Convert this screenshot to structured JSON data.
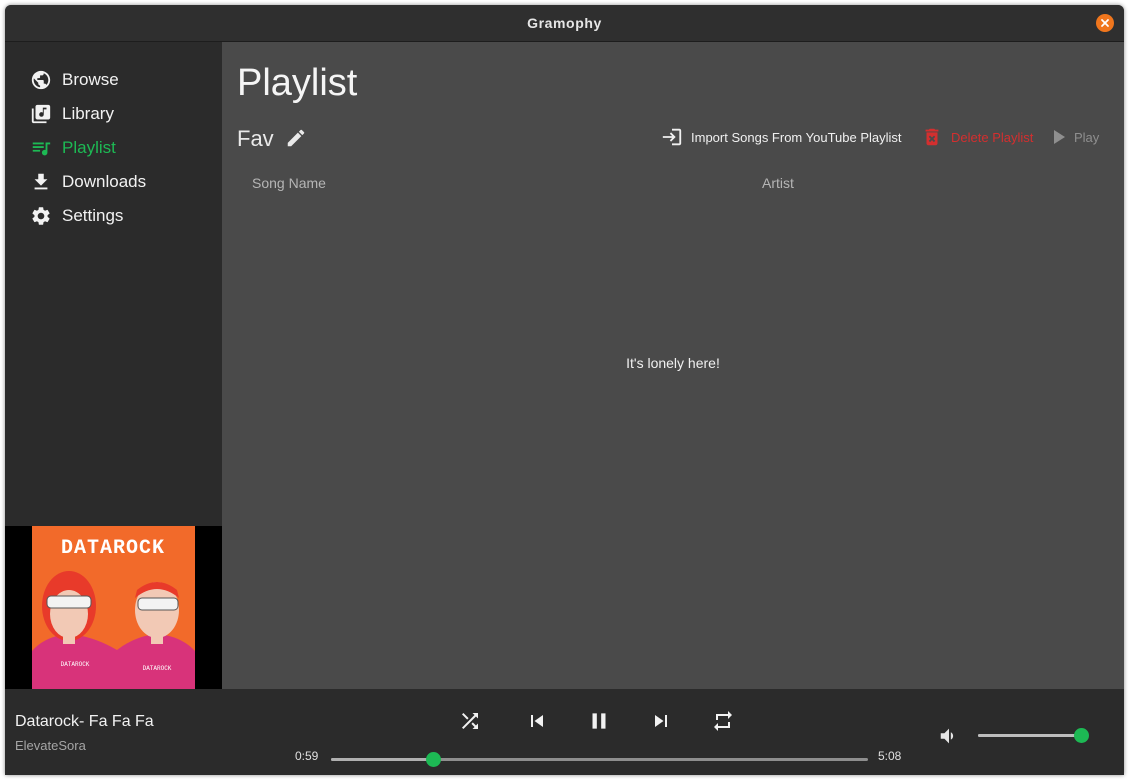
{
  "window": {
    "title": "Gramophy"
  },
  "colors": {
    "accent": "#1db954",
    "danger": "#d32f2f",
    "close": "#f0761d"
  },
  "sidebar": {
    "items": [
      {
        "label": "Browse",
        "icon": "globe-icon",
        "active": false
      },
      {
        "label": "Library",
        "icon": "library-icon",
        "active": false
      },
      {
        "label": "Playlist",
        "icon": "playlist-icon",
        "active": true
      },
      {
        "label": "Downloads",
        "icon": "download-icon",
        "active": false
      },
      {
        "label": "Settings",
        "icon": "settings-icon",
        "active": false
      }
    ],
    "album_art": {
      "band_text": "DATAROCK",
      "shirt_text_left": "DATAROCK",
      "shirt_text_right": "DATAROCK"
    }
  },
  "main": {
    "page_title": "Playlist",
    "playlist_name": "Fav",
    "actions": {
      "import_label": "Import Songs From YouTube Playlist",
      "delete_label": "Delete Playlist",
      "play_label": "Play"
    },
    "columns": [
      "Song Name",
      "Artist"
    ],
    "empty_message": "It's lonely here!"
  },
  "player": {
    "track_title": "Datarock- Fa Fa Fa",
    "track_artist": "ElevateSora",
    "current_time": "0:59",
    "total_time": "5:08",
    "progress": 0.19,
    "volume": 1.0
  }
}
